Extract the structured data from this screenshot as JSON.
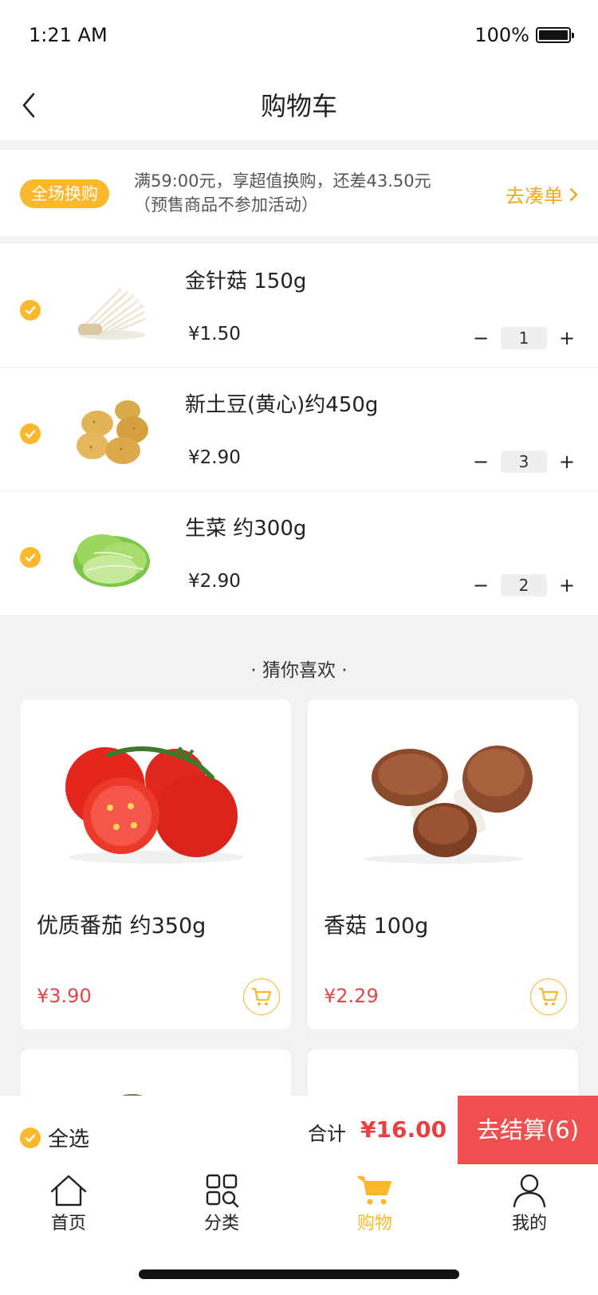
{
  "status": {
    "time": "1:21 AM",
    "battery": "100%"
  },
  "nav": {
    "title": "购物车"
  },
  "promo": {
    "badge": "全场换购",
    "line1": "满59:00元，享超值换购，还差43.50元",
    "line2": "（预售商品不参加活动）",
    "link": "去凑单"
  },
  "cart": {
    "items": [
      {
        "name": "金针菇   150g",
        "price": "¥1.50",
        "qty": "1"
      },
      {
        "name": "新土豆(黄心)约450g",
        "price": "¥2.90",
        "qty": "3"
      },
      {
        "name": "生菜    约300g",
        "price": "¥2.90",
        "qty": "2"
      }
    ]
  },
  "recommend": {
    "title": "· 猜你喜欢 ·",
    "items": [
      {
        "name": "优质番茄 约350g",
        "price": "¥3.90"
      },
      {
        "name": "香菇 100g",
        "price": "¥2.29"
      }
    ]
  },
  "checkout": {
    "select_all": "全选",
    "total_label": "合计",
    "total_value": "¥16.00",
    "button": "去结算(6)"
  },
  "tabs": [
    {
      "label": "首页",
      "icon": "home-icon"
    },
    {
      "label": "分类",
      "icon": "category-icon"
    },
    {
      "label": "购物",
      "icon": "cart-icon"
    },
    {
      "label": "我的",
      "icon": "user-icon"
    }
  ],
  "colors": {
    "accent": "#fbb82c",
    "price_red": "#e04848",
    "checkout_red": "#f04f4f"
  }
}
